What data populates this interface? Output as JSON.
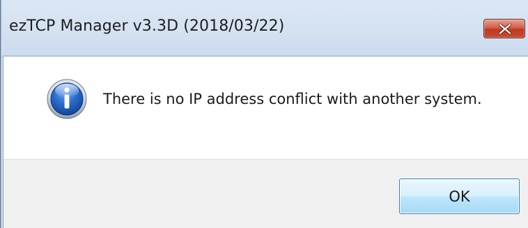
{
  "window": {
    "title": "ezTCP Manager v3.3D (2018/03/22)",
    "close_icon": "close-icon"
  },
  "dialog": {
    "icon": "info-icon",
    "message": "There is no IP address conflict with another system.",
    "ok_label": "OK"
  },
  "colors": {
    "titlebar": "#d3e1f1",
    "close_button": "#c74a32",
    "footer": "#f0f0f0",
    "ok_border": "#3c7fb1",
    "info_icon_blue": "#1d5bb5"
  }
}
